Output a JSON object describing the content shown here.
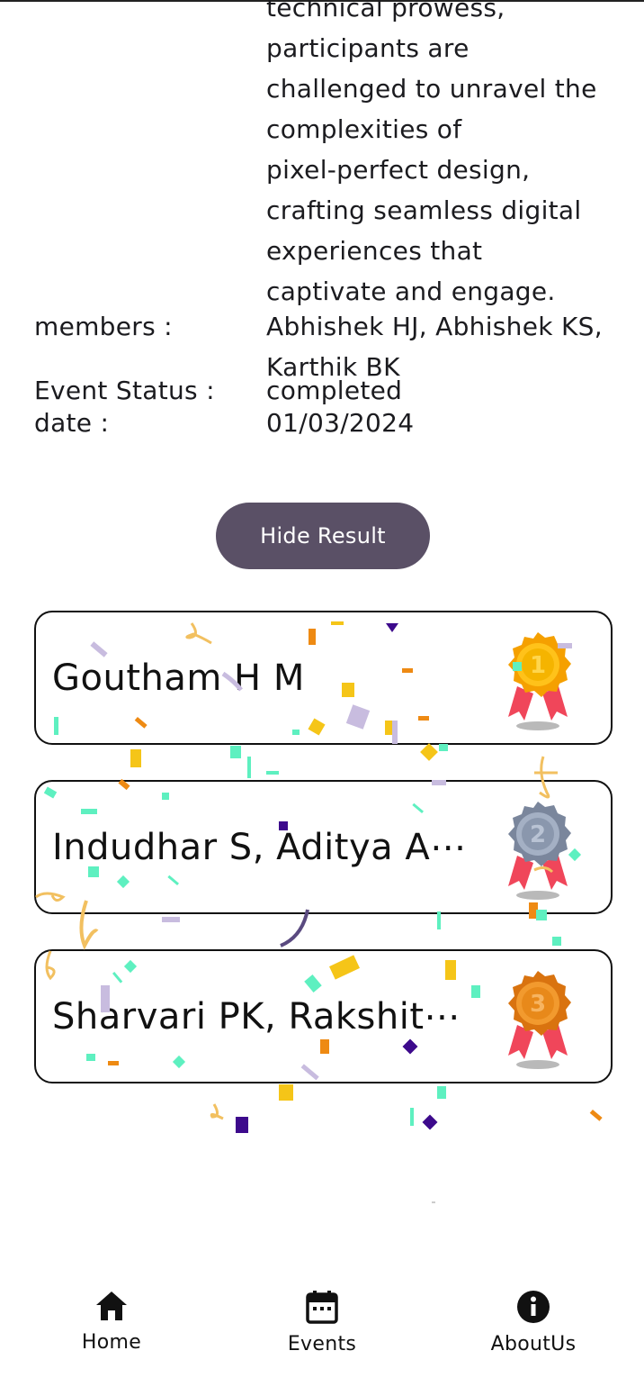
{
  "details": {
    "description_lines": [
      "technical prowess,",
      "participants are",
      "challenged to unravel the",
      "complexities of",
      "pixel-perfect design,",
      "crafting seamless digital",
      "experiences that",
      "captivate and engage."
    ],
    "members_label": "members :",
    "members_value": "Abhishek HJ, Abhishek KS, Karthik BK",
    "status_label": "Event Status :",
    "status_value": "completed",
    "date_label": "date :",
    "date_value": "01/03/2024"
  },
  "hide_result_label": "Hide Result",
  "results": [
    {
      "name": "Goutham H M",
      "medal": "gold-medal-icon",
      "rank": "1"
    },
    {
      "name": "Indudhar S, Aditya A⋯",
      "medal": "silver-medal-icon",
      "rank": "2"
    },
    {
      "name": "Sharvari PK, Rakshit⋯",
      "medal": "bronze-medal-icon",
      "rank": "3"
    }
  ],
  "nav": {
    "home": "Home",
    "events": "Events",
    "about": "AboutUs"
  },
  "colors": {
    "button": "#5a5066",
    "gold": "#f5b400",
    "silver": "#8a97ad",
    "bronze": "#e8891a",
    "ribbon": "#f0465a"
  }
}
